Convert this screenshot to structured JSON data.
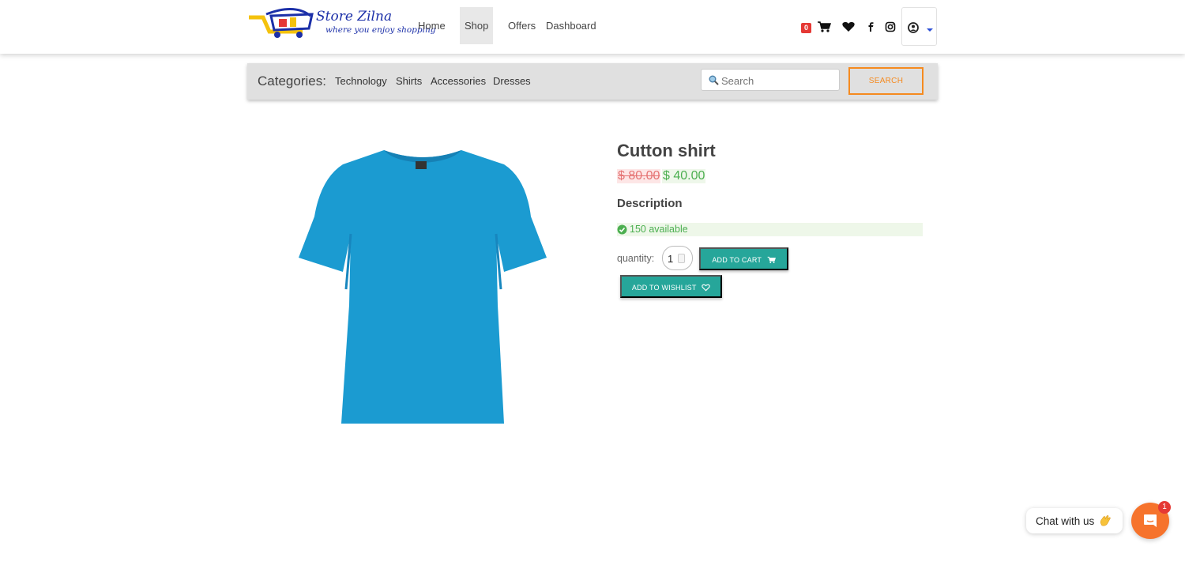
{
  "brand": {
    "name": "Store Zilna",
    "tagline": "where you enjoy shopping"
  },
  "nav": {
    "links": [
      "Home",
      "Shop",
      "Offers",
      "Dashboard"
    ],
    "active": "Shop",
    "cart_count": "0",
    "icons": [
      "cart-icon",
      "heart-icon",
      "facebook-icon",
      "instagram-icon",
      "user-icon",
      "caret-down-icon"
    ]
  },
  "categories": {
    "title": "Categories:",
    "items": [
      "Technology",
      "Shirts",
      "Accessories",
      "Dresses"
    ],
    "search_placeholder": "Search",
    "search_button": "SEARCH"
  },
  "product": {
    "name": "Cutton shirt",
    "old_price": "$ 80.00",
    "new_price": "$ 40.00",
    "description_label": "Description",
    "availability": "150 available",
    "quantity_label": "quantity:",
    "quantity_value": "1",
    "add_to_cart": "ADD TO CART",
    "add_to_wishlist": "ADD TO WISHLIST",
    "image_color": "#1b9bd1"
  },
  "chat": {
    "label": "Chat with us",
    "unread": "1"
  },
  "colors": {
    "accent_orange": "#f58a1f",
    "teal": "#26a69a",
    "chat_orange": "#f6732c",
    "badge_red": "#e53935"
  }
}
